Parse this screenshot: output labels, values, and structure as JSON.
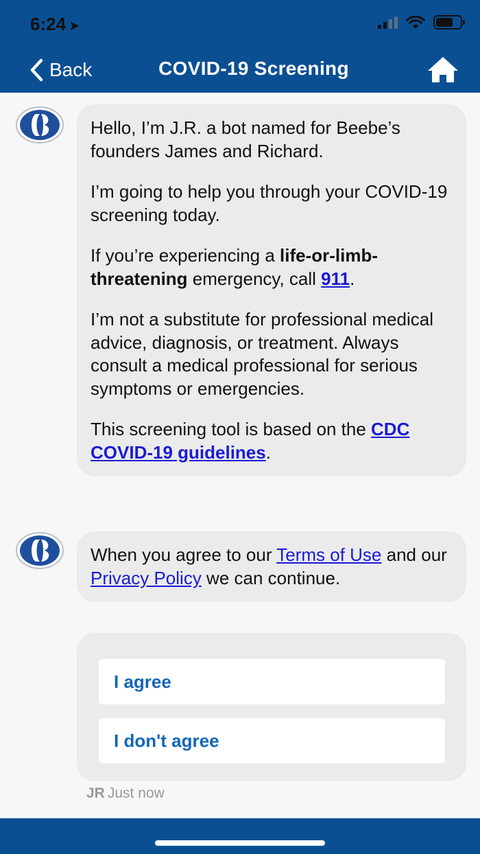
{
  "status_bar": {
    "time": "6:24",
    "location_icon": "location-arrow-icon",
    "signal_icon": "cellular-signal-icon",
    "wifi_icon": "wifi-icon",
    "battery_icon": "battery-icon"
  },
  "nav": {
    "back_label": "Back",
    "title": "COVID-19 Screening",
    "home_icon": "home-icon",
    "background_color": "#0b4f93"
  },
  "messages": [
    {
      "sender_avatar": "beebe-logo",
      "p1": "Hello, I’m J.R. a bot named for Beebe’s founders James and Richard.",
      "p2": "I’m going to help you through your COVID-19 screening today.",
      "p3_before": "If you’re experiencing a ",
      "p3_bold": "life-or-limb-threatening",
      "p3_middle": " emergency, call ",
      "p3_link": "911",
      "p3_after": ".",
      "p4": "I’m not a substitute for professional medical advice, diagnosis, or treatment. Always consult a medical professional for serious symptoms or emergencies.",
      "p5_before": "This screening tool is based on the ",
      "p5_link": "CDC COVID-19 guidelines",
      "p5_after": "."
    },
    {
      "sender_avatar": "beebe-logo",
      "before": "When you agree to our ",
      "terms_link": "Terms of Use",
      "middle": " and our ",
      "privacy_link": "Privacy Policy",
      "after": " we can continue."
    }
  ],
  "options": {
    "agree": "I agree",
    "disagree": "I don't agree"
  },
  "meta": {
    "sender": "JR",
    "time": "Just now"
  },
  "colors": {
    "brand_blue": "#0b4f93",
    "link_blue": "#1a1ad6",
    "button_text": "#1466b8"
  }
}
